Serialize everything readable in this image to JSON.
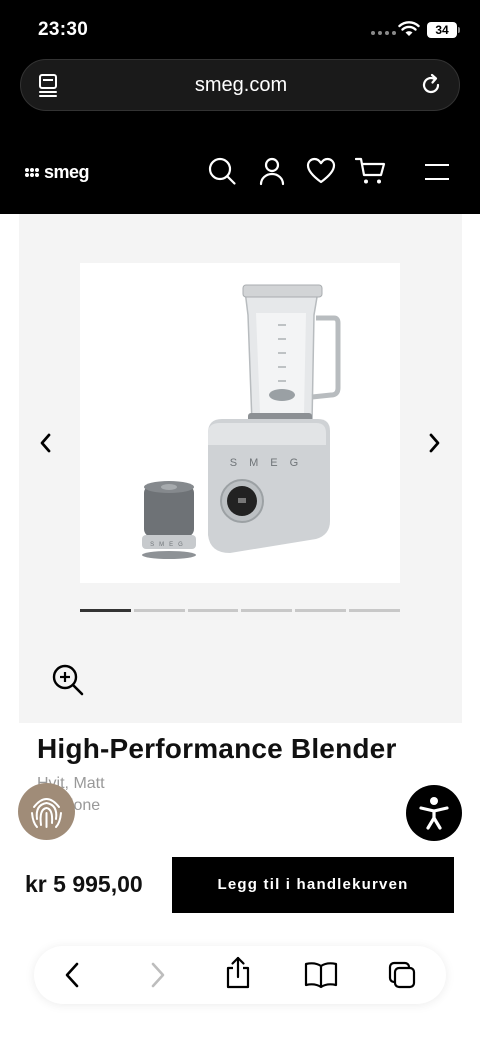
{
  "status_bar": {
    "time": "23:30",
    "battery": "34"
  },
  "browser": {
    "url": "smeg.com"
  },
  "site_nav": {
    "logo_text": "smeg"
  },
  "product": {
    "title": "High-Performance Blender",
    "color": "Hvit, Matt",
    "collection": "…ezione",
    "price": "kr 5 995,00",
    "add_to_cart_label": "Legg til i handlekurven",
    "gallery_slides": 6,
    "gallery_active_slide": 1,
    "logo_lettering": "SMEG"
  },
  "colors": {
    "topbar": "#000000",
    "gallery_bg": "#f4f4f4",
    "button": "#000000",
    "fingerprint_badge": "#a08c78"
  },
  "icons": [
    "tabs-icon",
    "reload-icon",
    "search-icon",
    "account-icon",
    "wishlist-icon",
    "cart-icon",
    "menu-icon",
    "chevron-left-icon",
    "chevron-right-icon",
    "zoom-in-icon",
    "fingerprint-icon",
    "accessibility-icon",
    "back-icon",
    "forward-icon",
    "share-icon",
    "bookmarks-icon",
    "tabs-overview-icon"
  ]
}
